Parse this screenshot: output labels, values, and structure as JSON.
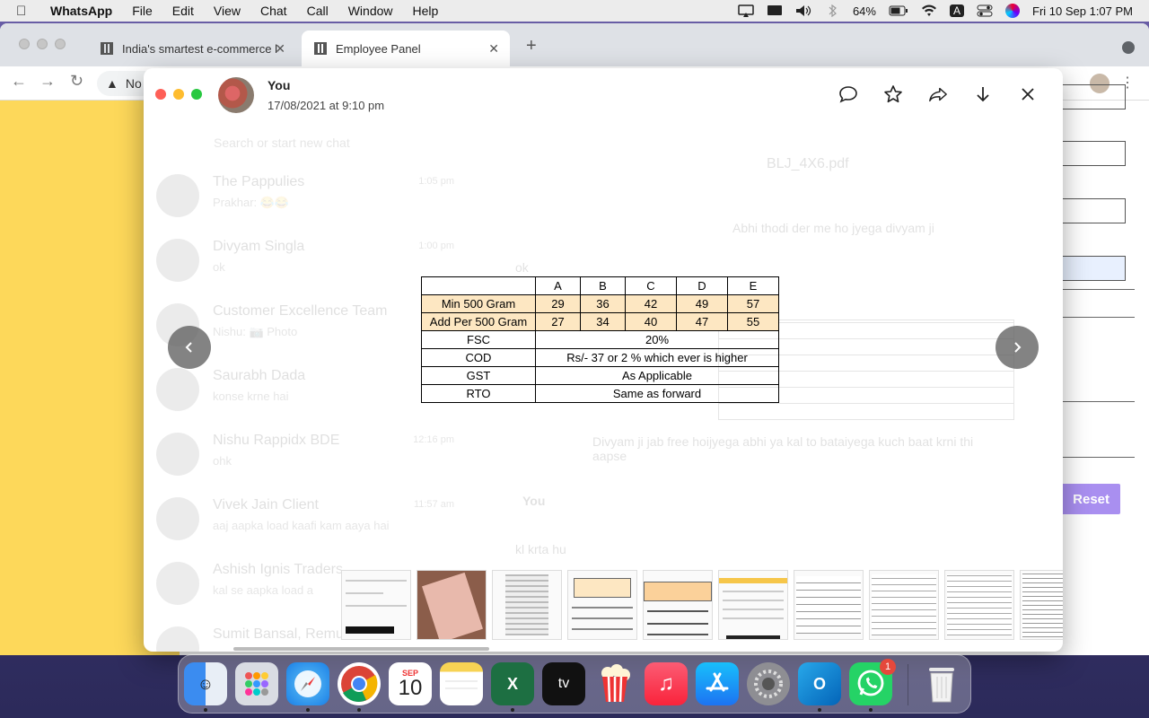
{
  "menubar": {
    "app_name": "WhatsApp",
    "items": [
      "File",
      "Edit",
      "View",
      "Chat",
      "Call",
      "Window",
      "Help"
    ],
    "battery": "64%",
    "input_source": "A",
    "datetime": "Fri 10 Sep  1:07 PM"
  },
  "browser": {
    "tabs": [
      {
        "title": "India's smartest e-commerce l"
      },
      {
        "title": "Employee Panel"
      }
    ],
    "omnibox_text": "No",
    "reset_label": "Reset"
  },
  "background_chat": {
    "search_placeholder": "Search or start new chat",
    "chats": [
      {
        "name": "The Pappulies",
        "preview": "Prakhar: 😂😂",
        "time": "1:05 pm"
      },
      {
        "name": "Divyam Singla",
        "preview": "ok",
        "time": "1:00 pm"
      },
      {
        "name": "Customer Excellence Team",
        "preview": "Nishu: 📷 Photo",
        "time": ""
      },
      {
        "name": "Saurabh Dada",
        "preview": "konse krne hai",
        "time": ""
      },
      {
        "name": "Nishu Rappidx BDE",
        "preview": "ohk",
        "time": "12:16 pm"
      },
      {
        "name": "Vivek Jain Client",
        "preview": "aaj aapka load kaafi kam aaya hai",
        "time": "11:57 am"
      },
      {
        "name": "Ashish Ignis Traders",
        "preview": "kal se aapka load a",
        "time": ""
      },
      {
        "name": "Sumit Bansal, Remu",
        "preview": "",
        "time": ""
      }
    ],
    "messages": [
      "BLJ_4X6.pdf",
      "Abhi thodi der me ho jyega divyam ji",
      "ok",
      "Divyam ji jab free hoijyega abhi ya kal to bataiyega kuch baat krni thi aapse",
      "You",
      "kl krta hu"
    ]
  },
  "viewer": {
    "sender": "You",
    "date": "17/08/2021 at 9:10 pm",
    "actions": [
      "reply-icon",
      "star-icon",
      "forward-icon",
      "download-icon",
      "close-icon"
    ]
  },
  "rate_table": {
    "headers": [
      "",
      "A",
      "B",
      "C",
      "D",
      "E"
    ],
    "min_row": {
      "label": "Min 500 Gram",
      "values": [
        "29",
        "36",
        "42",
        "49",
        "57"
      ]
    },
    "add_row": {
      "label": "Add Per 500 Gram",
      "values": [
        "27",
        "34",
        "40",
        "47",
        "55"
      ]
    },
    "fsc": {
      "label": "FSC",
      "value": "20%"
    },
    "cod": {
      "label": "COD",
      "value": "Rs/- 37 or 2 % which ever is higher"
    },
    "gst": {
      "label": "GST",
      "value": "As Applicable"
    },
    "rto": {
      "label": "RTO",
      "value": "Same as forward"
    },
    "fill_color": "#fde7c2"
  },
  "thumbnails": [
    {
      "kind": "document"
    },
    {
      "kind": "photo"
    },
    {
      "kind": "document"
    },
    {
      "kind": "rate-table"
    },
    {
      "kind": "rate-table-zoom"
    },
    {
      "kind": "spreadsheet"
    },
    {
      "kind": "spreadsheet"
    },
    {
      "kind": "report"
    },
    {
      "kind": "report"
    },
    {
      "kind": "list"
    }
  ],
  "dock": {
    "calendar_month": "SEP",
    "calendar_day": "10",
    "tv_label": "tv",
    "whatsapp_badge": "1",
    "apps": [
      "Finder",
      "Launchpad",
      "Safari",
      "Chrome",
      "Calendar",
      "Notes",
      "Excel",
      "TV",
      "Popcorn Time",
      "Music",
      "App Store",
      "System Preferences",
      "Outlook",
      "WhatsApp",
      "Trash"
    ]
  },
  "colors": {
    "whatsapp_green": "#25d366",
    "page_yellow": "#fdd85a",
    "reset_purple": "#a98ff0"
  }
}
